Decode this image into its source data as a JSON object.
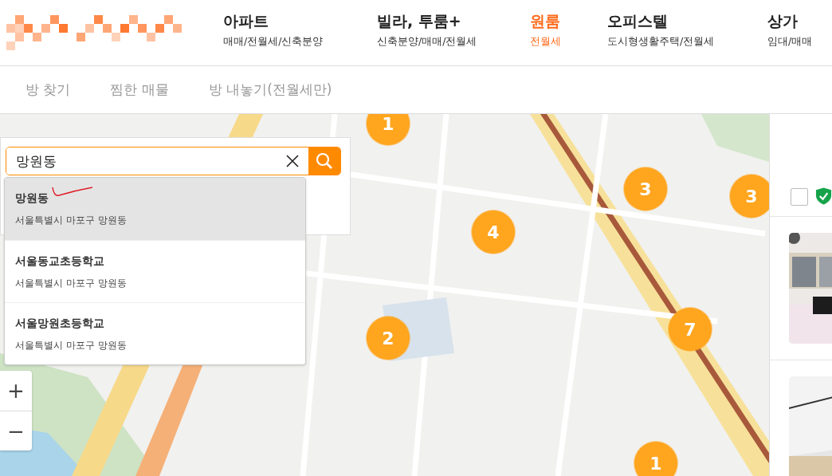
{
  "nav": [
    {
      "label": "아파트",
      "sub": "매매/전월세/신축분양",
      "selected": false
    },
    {
      "label": "빌라, 투룸+",
      "sub": "신축분양/매매/전월세",
      "selected": false
    },
    {
      "label": "원룸",
      "sub": "전월세",
      "selected": true
    },
    {
      "label": "오피스텔",
      "sub": "도시형생활주택/전월세",
      "selected": false
    },
    {
      "label": "상가",
      "sub": "임대/매매",
      "selected": false
    }
  ],
  "tabs": [
    {
      "label": "방 찾기",
      "selected": false
    },
    {
      "label": "찜한 매물",
      "selected": false
    },
    {
      "label": "방 내놓기(전월세만)",
      "selected": false
    }
  ],
  "search": {
    "value": "망원동",
    "suggestions": [
      {
        "name": "망원동",
        "address": "서울특별시 마포구 망원동",
        "selected": true
      },
      {
        "name": "서울동교초등학교",
        "address": "서울특별시 마포구 망원동",
        "selected": false
      },
      {
        "name": "서울망원초등학교",
        "address": "서울특별시 마포구 망원동",
        "selected": false
      }
    ]
  },
  "map": {
    "clusters": [
      {
        "count": "1"
      },
      {
        "count": "3"
      },
      {
        "count": "3"
      },
      {
        "count": "4"
      },
      {
        "count": "2"
      },
      {
        "count": "7"
      },
      {
        "count": "1"
      }
    ],
    "zoom_controls": [
      "+",
      "−"
    ]
  },
  "listings": {
    "select_all": {
      "checked": false
    }
  }
}
